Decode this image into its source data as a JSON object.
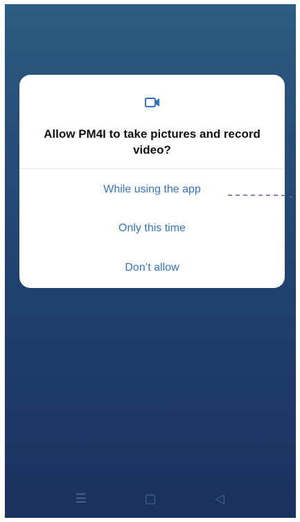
{
  "dialog": {
    "icon": "video-camera-icon",
    "title": "Allow PM4I to take pictures and record video?",
    "options": [
      "While using the app",
      "Only this time",
      "Don’t allow"
    ]
  },
  "nav": {
    "icons": [
      "menu-icon",
      "home-icon",
      "back-icon"
    ]
  },
  "colors": {
    "accent": "#2f73c9",
    "background_top": "#2b5c81",
    "background_bottom": "#1b3160"
  }
}
